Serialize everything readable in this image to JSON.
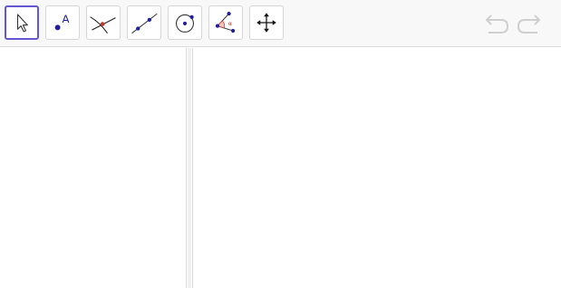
{
  "toolbar": {
    "tools": [
      {
        "id": "move",
        "icon": "arrow-pointer-icon",
        "selected": true
      },
      {
        "id": "point",
        "icon": "point-icon",
        "label": "A",
        "selected": false
      },
      {
        "id": "intersect",
        "icon": "intersect-icon",
        "selected": false
      },
      {
        "id": "line",
        "icon": "line-icon",
        "selected": false
      },
      {
        "id": "circle",
        "icon": "circle-icon",
        "selected": false
      },
      {
        "id": "angle",
        "icon": "angle-icon",
        "label": "α",
        "selected": false
      },
      {
        "id": "move-graphics-view",
        "icon": "move-arrows-icon",
        "selected": false
      }
    ],
    "undo_icon": "undo-icon",
    "redo_icon": "redo-icon"
  },
  "colors": {
    "accent": "#6557d2",
    "point_blue": "#1e1ea0",
    "point_red": "#c0392b",
    "history_gray": "#cfcfcf"
  }
}
